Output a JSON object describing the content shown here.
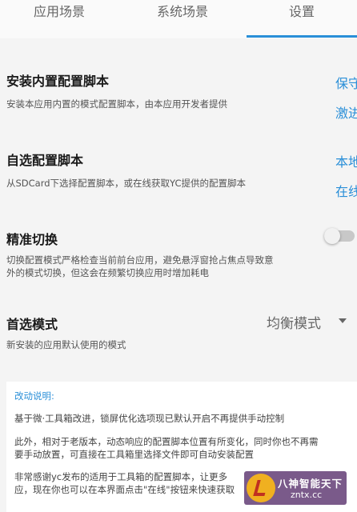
{
  "tabs": [
    {
      "label": "应用场景"
    },
    {
      "label": "系统场景"
    },
    {
      "label": "设置"
    }
  ],
  "sections": {
    "builtin": {
      "title": "安装内置配置脚本",
      "desc": "安装本应用内置的模式配置脚本，由本应用开发者提供",
      "links": [
        "保守",
        "激进"
      ]
    },
    "custom": {
      "title": "自选配置脚本",
      "desc": "从SDCard下选择配置脚本，或在线获取YC提供的配置脚本",
      "links": [
        "本地",
        "在线"
      ]
    },
    "precise": {
      "title": "精准切换",
      "desc_line1": "切换配置模式严格检查当前前台应用，避免悬浮窗抢占焦点导致意",
      "desc_line2": "外的模式切换，但这会在频繁切换应用时增加耗电",
      "enabled": false
    },
    "preferred": {
      "title": "首选模式",
      "desc": "新安装的应用默认使用的模式",
      "selected": "均衡模式"
    }
  },
  "changelog": {
    "title": "改动说明:",
    "p1": "基于微·工具箱改进，锁屏优化选项现已默认开启不再提供手动控制",
    "p2_line1": "此外，相对于老版本，动态响应的配置脚本位置有所变化，同时你也不再需",
    "p2_line2": "要手动放置，可直接在工具箱里选择文件即可自动安装配置",
    "p3_line1": "非常感谢yc发布的适用于工具箱的配置脚本，让更多",
    "p3_line2": "应，现在你也可以在本界面点击\"在线\"按钮来快速获取"
  },
  "watermark": {
    "text": "八神智能天下",
    "url": "zntx.cc"
  },
  "colors": {
    "accent": "#2a8fd8",
    "background": "#f4f4f4"
  }
}
